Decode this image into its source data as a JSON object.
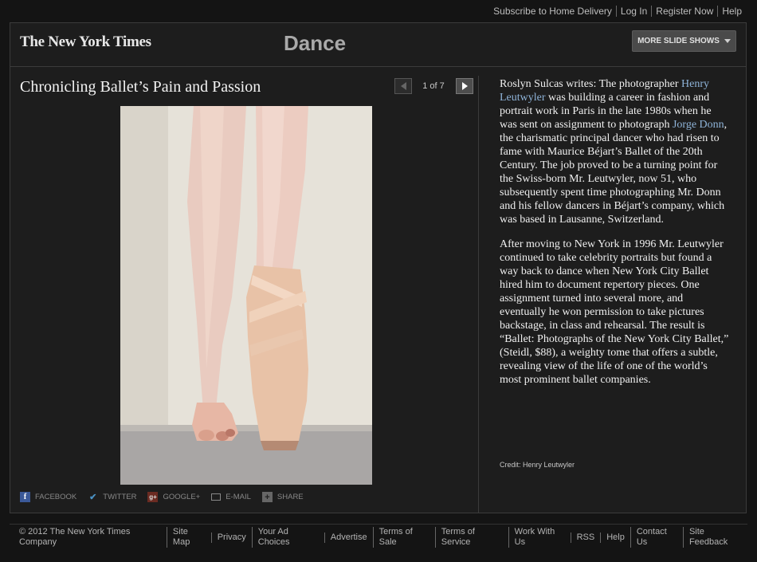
{
  "top_links": [
    "Subscribe to Home Delivery",
    "Log In",
    "Register Now",
    "Help"
  ],
  "header": {
    "logo_text": "The New York Times",
    "section": "Dance",
    "more_button": "MORE SLIDE SHOWS"
  },
  "slideshow": {
    "title": "Chronicling Ballet’s Pain and Passion",
    "counter": "1 of 7"
  },
  "article": {
    "p1_a": "Roslyn Sulcas writes: The photographer ",
    "p1_link1": "Henry Leutwyler",
    "p1_b": " was building a career in fashion and portrait work in Paris in the late 1980s when he was sent on assignment to photograph ",
    "p1_link2": "Jorge Donn",
    "p1_c": ", the charismatic principal dancer who had risen to fame with Maurice Béjart’s Ballet of the 20th Century. The job proved to be a turning point for the Swiss-born Mr. Leutwyler, now 51, who subsequently spent time photographing Mr. Donn and his fellow dancers in Béjart’s company, which was based in Lausanne, Switzerland.",
    "p2": "After moving to New York in 1996 Mr. Leutwyler continued to take celebrity portraits but found a way back to dance when New York City Ballet hired him to document repertory pieces. One assignment turned into several more, and eventually he won permission to take pictures backstage, in class and rehearsal. The result is “Ballet: Photographs of the New York City Ballet,” (Steidl, $88), a weighty tome that offers a subtle, revealing view of the life of one of the world’s most prominent ballet companies.",
    "credit": "Credit: Henry Leutwyler"
  },
  "share": {
    "facebook": "FACEBOOK",
    "twitter": "TWITTER",
    "googleplus": "GOOGLE+",
    "email": "E-MAIL",
    "share": "SHARE",
    "fb_glyph": "f",
    "tw_glyph": "✔",
    "gp_glyph": "g+",
    "sh_glyph": "+"
  },
  "footer": [
    "© 2012 The New York Times Company",
    "Site Map",
    "Privacy",
    "Your Ad Choices",
    "Advertise",
    "Terms of Sale",
    "Terms of Service",
    "Work With Us",
    "RSS",
    "Help",
    "Contact Us",
    "Site Feedback"
  ],
  "colors": {
    "background": "#141414",
    "panel": "#1d1d1d",
    "link": "#8fb4d9"
  }
}
